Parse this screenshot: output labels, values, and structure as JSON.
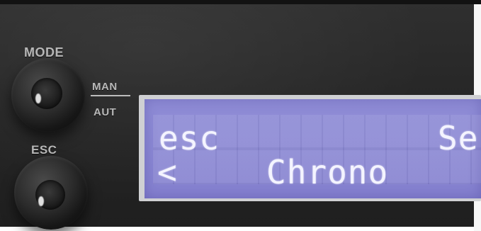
{
  "panel": {
    "mode_label": "MODE",
    "esc_label": "ESC",
    "man_label": "MAN",
    "aut_label": "AUT"
  },
  "lcd": {
    "row1_left": "esc",
    "row1_right": "Se",
    "row2_arrow": "<",
    "row2_center": "Chrono"
  },
  "colors": {
    "lcd_background": "#8a87d3",
    "lcd_text": "#f4f4ff",
    "panel": "#262626",
    "bezel": "#cfd0d3"
  },
  "icons": {
    "mode_knob": "rotary-knob",
    "esc_knob": "push-button"
  }
}
